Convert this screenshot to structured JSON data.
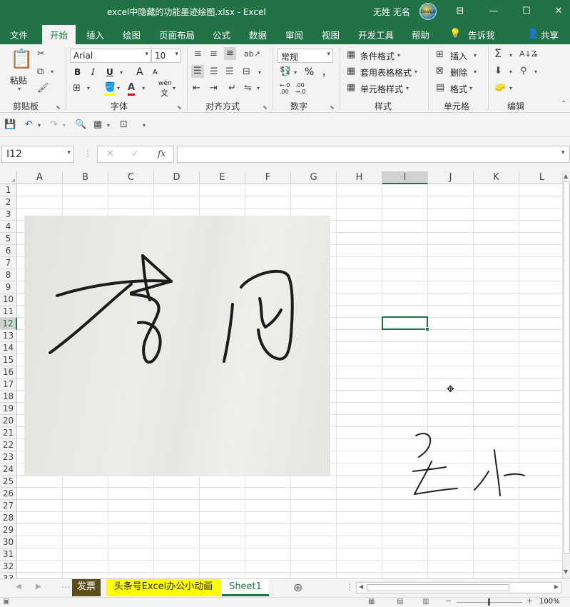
{
  "window": {
    "title": "excel中隐藏的功能墨迹绘图.xlsx  -  Excel",
    "user_name": "无姓 无名",
    "avatar_text": "Design"
  },
  "ribbon_tabs": [
    "文件",
    "开始",
    "插入",
    "绘图",
    "页面布局",
    "公式",
    "数据",
    "审阅",
    "视图",
    "开发工具",
    "帮助",
    "告诉我",
    "共享"
  ],
  "ribbon": {
    "clipboard": {
      "paste": "粘贴",
      "group": "剪贴板"
    },
    "font": {
      "name": "Arial",
      "size": "10",
      "bold": "B",
      "italic": "I",
      "underline": "U",
      "grow": "A",
      "shrink": "A",
      "phonetic": "wén",
      "phonetic_char": "文",
      "group": "字体"
    },
    "alignment": {
      "group": "对齐方式"
    },
    "number": {
      "format": "常规",
      "percent": "%",
      "comma": "，",
      "inc_decimal": "←.0\n.00",
      "dec_decimal": ".00\n→.0",
      "group": "数字"
    },
    "styles": {
      "conditional": "条件格式",
      "table": "套用表格格式",
      "cell": "单元格样式",
      "group": "样式"
    },
    "cells": {
      "insert": "插入",
      "delete": "删除",
      "format": "格式",
      "group": "单元格"
    },
    "editing": {
      "group": "编辑"
    }
  },
  "formula_bar": {
    "name_box": "I12",
    "fx": "fx",
    "value": ""
  },
  "columns": [
    "A",
    "B",
    "C",
    "D",
    "E",
    "F",
    "G",
    "H",
    "I",
    "J",
    "K",
    "L"
  ],
  "rows": [
    "1",
    "2",
    "3",
    "4",
    "5",
    "6",
    "7",
    "8",
    "9",
    "10",
    "11",
    "12",
    "13",
    "14",
    "15",
    "16",
    "17",
    "18",
    "19",
    "20",
    "21",
    "22",
    "23",
    "24",
    "25",
    "26",
    "27",
    "28",
    "29",
    "30",
    "31",
    "32",
    "33"
  ],
  "selection": {
    "column": "I",
    "row": "12"
  },
  "sheets": [
    "发票",
    "头条号Excel办公小动画",
    "Sheet1"
  ],
  "active_sheet": "Sheet1",
  "status": {
    "zoom": "100%"
  },
  "colors": {
    "accent": "#217346",
    "sheet_invoice_bg": "#5b4e1d",
    "sheet_yellow_bg": "#ffff00"
  }
}
